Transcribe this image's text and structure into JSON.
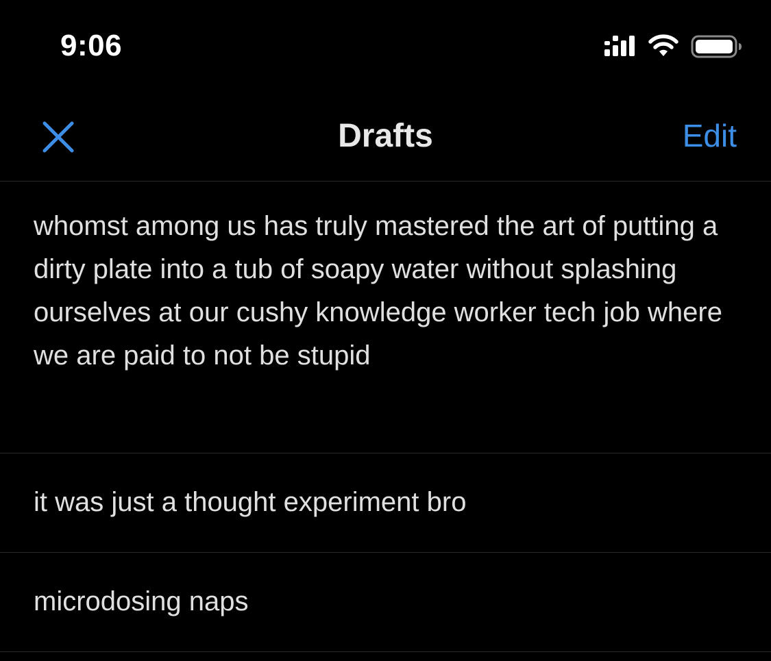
{
  "status_bar": {
    "time": "9:06"
  },
  "nav": {
    "title": "Drafts",
    "edit_label": "Edit",
    "close_icon": "close-icon",
    "accent_color": "#3d8ee6"
  },
  "drafts": [
    {
      "text": "whomst among us has truly mastered the art of putting a dirty plate into a tub of soapy water without splashing ourselves at our cushy knowledge worker tech job where we are paid to not be stupid"
    },
    {
      "text": "it was just a thought experiment bro"
    },
    {
      "text": "microdosing naps"
    }
  ]
}
